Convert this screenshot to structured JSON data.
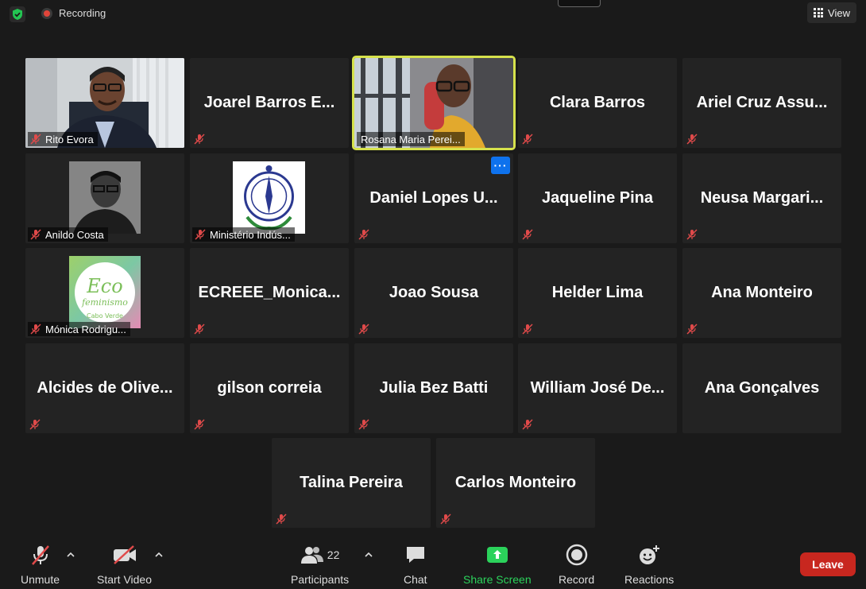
{
  "top": {
    "recording": "Recording",
    "view": "View"
  },
  "participants": [
    {
      "name": "Rito Evora",
      "display": "",
      "plate": "Rito Evora",
      "video": true
    },
    {
      "name": "Joarel Barros E...",
      "display": "Joarel  Barros  E...",
      "plate": ""
    },
    {
      "name": "Rosana Maria Pereira",
      "display": "",
      "plate": "Rosana Maria Perei...",
      "video": true,
      "active": true
    },
    {
      "name": "Clara Barros",
      "display": "Clara Barros",
      "plate": ""
    },
    {
      "name": "Ariel Cruz Assu...",
      "display": "Ariel  Cruz  Assu...",
      "plate": ""
    },
    {
      "name": "Anildo Costa",
      "display": "",
      "plate": "Anildo Costa",
      "video": true
    },
    {
      "name": "Ministério Indústria",
      "display": "",
      "plate": "Ministério Indús...",
      "video": true
    },
    {
      "name": "Daniel Lopes U...",
      "display": "Daniel  Lopes  U...",
      "plate": "",
      "more": "···"
    },
    {
      "name": "Jaqueline Pina",
      "display": "Jaqueline Pina",
      "plate": ""
    },
    {
      "name": "Neusa Margari...",
      "display": "Neusa  Margari...",
      "plate": ""
    },
    {
      "name": "Mónica Rodrigues",
      "display": "",
      "plate": "Mónica Rodrigu...",
      "video": true
    },
    {
      "name": "ECREEE_Monica...",
      "display": "ECREEE_Monica...",
      "plate": ""
    },
    {
      "name": "Joao Sousa",
      "display": "Joao Sousa",
      "plate": ""
    },
    {
      "name": "Helder Lima",
      "display": "Helder Lima",
      "plate": ""
    },
    {
      "name": "Ana Monteiro",
      "display": "Ana Monteiro",
      "plate": ""
    },
    {
      "name": "Alcides de Olive...",
      "display": "Alcides  de  Olive...",
      "plate": ""
    },
    {
      "name": "gilson correia",
      "display": "gilson correia",
      "plate": ""
    },
    {
      "name": "Julia Bez Batti",
      "display": "Julia Bez Batti",
      "plate": ""
    },
    {
      "name": "William José De...",
      "display": "William  José  De...",
      "plate": ""
    },
    {
      "name": "Ana Gonçalves",
      "display": "Ana Gonçalves",
      "plate": ""
    },
    {
      "name": "Talina Pereira",
      "display": "Talina Pereira",
      "plate": ""
    },
    {
      "name": "Carlos Monteiro",
      "display": "Carlos Monteiro",
      "plate": ""
    }
  ],
  "logo_text": {
    "eco": "Eco",
    "feminismo": "feminismo",
    "cv": "Cabo Verde",
    "seal": "REPÚBLICA DE CABO VERDE"
  },
  "toolbar": {
    "unmute": "Unmute",
    "start_video": "Start Video",
    "participants": "Participants",
    "participants_count": "22",
    "chat": "Chat",
    "share": "Share Screen",
    "record": "Record",
    "reactions": "Reactions",
    "leave": "Leave"
  },
  "colors": {
    "active_border": "#d6e24c",
    "share_green": "#2bd25b",
    "leave_red": "#c8271f",
    "more_blue": "#0e72ed"
  }
}
